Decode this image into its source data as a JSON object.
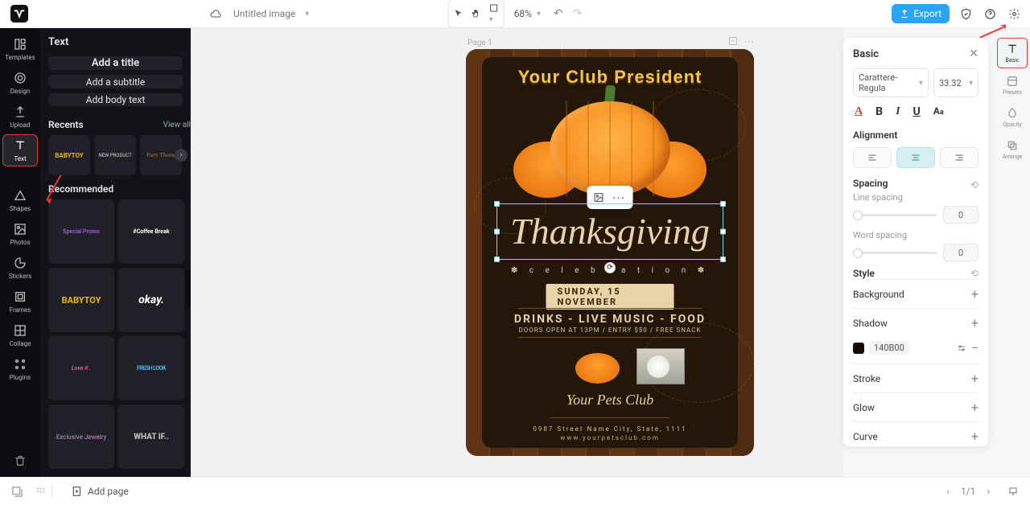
{
  "topbar": {
    "title": "Untitled image",
    "zoom": "68%",
    "export": "Export"
  },
  "rail": {
    "items": [
      {
        "label": "Templates"
      },
      {
        "label": "Design"
      },
      {
        "label": "Upload"
      },
      {
        "label": "Text"
      },
      {
        "label": "Shapes"
      },
      {
        "label": "Photos"
      },
      {
        "label": "Stickers"
      },
      {
        "label": "Frames"
      },
      {
        "label": "Collage"
      },
      {
        "label": "Plugins"
      }
    ]
  },
  "sidepanel": {
    "title": "Text",
    "add_title": "Add a title",
    "add_subtitle": "Add a subtitle",
    "add_body": "Add body text",
    "recents_label": "Recents",
    "view_all": "View all",
    "recents": [
      "BABYTOY",
      "NEW PRODUCT",
      "Party Theme"
    ],
    "recommended_label": "Recommended",
    "recommended": [
      "Special Promo",
      "#Coffee Break",
      "BABYTOY",
      "okay.",
      "Love it .",
      "FRESH LOOK",
      "Exclusive Jewelry",
      "WHAT IF.."
    ]
  },
  "canvas": {
    "page_label": "Page 1",
    "flyer": {
      "header": "Your Club President",
      "main_title": "Thanksgiving",
      "celebration": "✽ c e l e b r a t i o n ✽",
      "date": "SUNDAY, 15 NOVEMBER",
      "info": "DRINKS - LIVE MUSIC - FOOD",
      "small": "DOORS OPEN AT 13PM / ENTRY $50 / FREE SNACK",
      "club": "Your Pets Club",
      "address": "0987 Street Name City, State, 1111",
      "url": "www.yourpetsclub.com"
    }
  },
  "right_panel": {
    "title": "Basic",
    "font": "Carattere-Regula",
    "size": "33.32",
    "alignment_label": "Alignment",
    "spacing_label": "Spacing",
    "line_spacing": "Line spacing",
    "word_spacing": "Word spacing",
    "line_val": "0",
    "word_val": "0",
    "style_label": "Style",
    "background": "Background",
    "shadow": "Shadow",
    "shadow_hex": "140B00",
    "stroke": "Stroke",
    "glow": "Glow",
    "curve": "Curve"
  },
  "prop_rail": {
    "items": [
      {
        "label": "Basic"
      },
      {
        "label": "Presets"
      },
      {
        "label": "Opacity"
      },
      {
        "label": "Arrange"
      }
    ]
  },
  "bottombar": {
    "add_page": "Add page",
    "page_indicator": "1/1"
  }
}
